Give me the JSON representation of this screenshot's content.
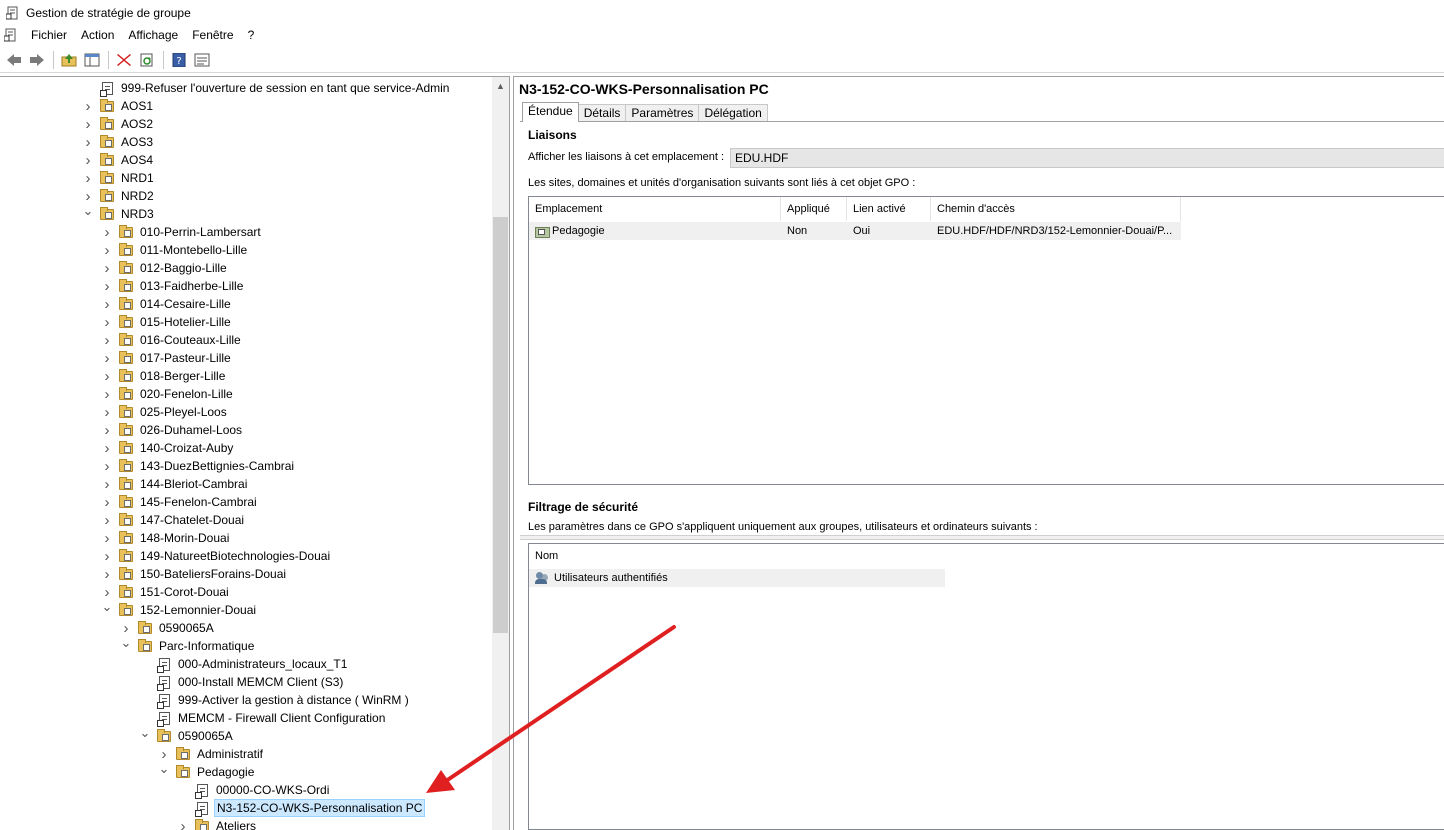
{
  "window": {
    "title": "Gestion de stratégie de groupe"
  },
  "menu": [
    "Fichier",
    "Action",
    "Affichage",
    "Fenêtre",
    "?"
  ],
  "toolbar": {
    "buttons": [
      "back-icon",
      "forward-icon",
      "up-folder-icon",
      "show-hide-tree-icon",
      "delete-icon",
      "refresh-icon",
      "help-icon",
      "properties-icon"
    ]
  },
  "tree": {
    "items": [
      {
        "label": "999-Refuser l'ouverture de session en tant que service-Admin",
        "type": "gpo",
        "expander": "none",
        "level": 0
      },
      {
        "label": "AOS1",
        "type": "ou",
        "expander": "collapsed",
        "level": 0
      },
      {
        "label": "AOS2",
        "type": "ou",
        "expander": "collapsed",
        "level": 0
      },
      {
        "label": "AOS3",
        "type": "ou",
        "expander": "collapsed",
        "level": 0
      },
      {
        "label": "AOS4",
        "type": "ou",
        "expander": "collapsed",
        "level": 0
      },
      {
        "label": "NRD1",
        "type": "ou",
        "expander": "collapsed",
        "level": 0
      },
      {
        "label": "NRD2",
        "type": "ou",
        "expander": "collapsed",
        "level": 0
      },
      {
        "label": "NRD3",
        "type": "ou",
        "expander": "expanded",
        "level": 0
      },
      {
        "label": "010-Perrin-Lambersart",
        "type": "ou",
        "expander": "collapsed",
        "level": 1
      },
      {
        "label": "011-Montebello-Lille",
        "type": "ou",
        "expander": "collapsed",
        "level": 1
      },
      {
        "label": "012-Baggio-Lille",
        "type": "ou",
        "expander": "collapsed",
        "level": 1
      },
      {
        "label": "013-Faidherbe-Lille",
        "type": "ou",
        "expander": "collapsed",
        "level": 1
      },
      {
        "label": "014-Cesaire-Lille",
        "type": "ou",
        "expander": "collapsed",
        "level": 1
      },
      {
        "label": "015-Hotelier-Lille",
        "type": "ou",
        "expander": "collapsed",
        "level": 1
      },
      {
        "label": "016-Couteaux-Lille",
        "type": "ou",
        "expander": "collapsed",
        "level": 1
      },
      {
        "label": "017-Pasteur-Lille",
        "type": "ou",
        "expander": "collapsed",
        "level": 1
      },
      {
        "label": "018-Berger-Lille",
        "type": "ou",
        "expander": "collapsed",
        "level": 1
      },
      {
        "label": "020-Fenelon-Lille",
        "type": "ou",
        "expander": "collapsed",
        "level": 1
      },
      {
        "label": "025-Pleyel-Loos",
        "type": "ou",
        "expander": "collapsed",
        "level": 1
      },
      {
        "label": "026-Duhamel-Loos",
        "type": "ou",
        "expander": "collapsed",
        "level": 1
      },
      {
        "label": "140-Croizat-Auby",
        "type": "ou",
        "expander": "collapsed",
        "level": 1
      },
      {
        "label": "143-DuezBettignies-Cambrai",
        "type": "ou",
        "expander": "collapsed",
        "level": 1
      },
      {
        "label": "144-Bleriot-Cambrai",
        "type": "ou",
        "expander": "collapsed",
        "level": 1
      },
      {
        "label": "145-Fenelon-Cambrai",
        "type": "ou",
        "expander": "collapsed",
        "level": 1
      },
      {
        "label": "147-Chatelet-Douai",
        "type": "ou",
        "expander": "collapsed",
        "level": 1
      },
      {
        "label": "148-Morin-Douai",
        "type": "ou",
        "expander": "collapsed",
        "level": 1
      },
      {
        "label": "149-NatureetBiotechnologies-Douai",
        "type": "ou",
        "expander": "collapsed",
        "level": 1
      },
      {
        "label": "150-BateliersForains-Douai",
        "type": "ou",
        "expander": "collapsed",
        "level": 1
      },
      {
        "label": "151-Corot-Douai",
        "type": "ou",
        "expander": "collapsed",
        "level": 1
      },
      {
        "label": "152-Lemonnier-Douai",
        "type": "ou",
        "expander": "expanded",
        "level": 1
      },
      {
        "label": "0590065A",
        "type": "ou",
        "expander": "collapsed",
        "level": 2
      },
      {
        "label": "Parc-Informatique",
        "type": "ou",
        "expander": "expanded",
        "level": 2
      },
      {
        "label": "000-Administrateurs_locaux_T1",
        "type": "gpo",
        "expander": "none",
        "level": 3
      },
      {
        "label": "000-Install MEMCM Client (S3)",
        "type": "gpo",
        "expander": "none",
        "level": 3
      },
      {
        "label": "999-Activer la gestion à distance ( WinRM )",
        "type": "gpo",
        "expander": "none",
        "level": 3
      },
      {
        "label": "MEMCM - Firewall Client Configuration",
        "type": "gpo",
        "expander": "none",
        "level": 3
      },
      {
        "label": "0590065A",
        "type": "ou",
        "expander": "expanded",
        "level": 3
      },
      {
        "label": "Administratif",
        "type": "ou",
        "expander": "collapsed",
        "level": 4
      },
      {
        "label": "Pedagogie",
        "type": "ou",
        "expander": "expanded",
        "level": 4
      },
      {
        "label": "00000-CO-WKS-Ordi",
        "type": "gpo",
        "expander": "none",
        "level": 5
      },
      {
        "label": "N3-152-CO-WKS-Personnalisation PC",
        "type": "gpo",
        "expander": "none",
        "level": 5,
        "selected": true
      },
      {
        "label": "Ateliers",
        "type": "ou",
        "expander": "collapsed",
        "level": 5
      }
    ]
  },
  "details": {
    "gpo_title": "N3-152-CO-WKS-Personnalisation PC",
    "tabs": [
      "Étendue",
      "Détails",
      "Paramètres",
      "Délégation"
    ],
    "active_tab": "Étendue",
    "links": {
      "section_title": "Liaisons",
      "location_label": "Afficher les liaisons à cet emplacement :",
      "location_value": "EDU.HDF",
      "description": "Les sites, domaines et unités d'organisation suivants sont liés à cet objet GPO :",
      "columns": [
        "Emplacement",
        "Appliqué",
        "Lien activé",
        "Chemin d'accès"
      ],
      "rows": [
        {
          "location": "Pedagogie",
          "enforced": "Non",
          "enabled": "Oui",
          "path": "EDU.HDF/HDF/NRD3/152-Lemonnier-Douai/P..."
        }
      ]
    },
    "security": {
      "section_title": "Filtrage de sécurité",
      "description": "Les paramètres dans ce GPO s'appliquent uniquement aux groupes, utilisateurs et ordinateurs suivants :",
      "columns": [
        "Nom"
      ],
      "rows": [
        {
          "name": "Utilisateurs authentifiés"
        }
      ]
    }
  },
  "annotation": {
    "arrow_color": "#e02020"
  }
}
